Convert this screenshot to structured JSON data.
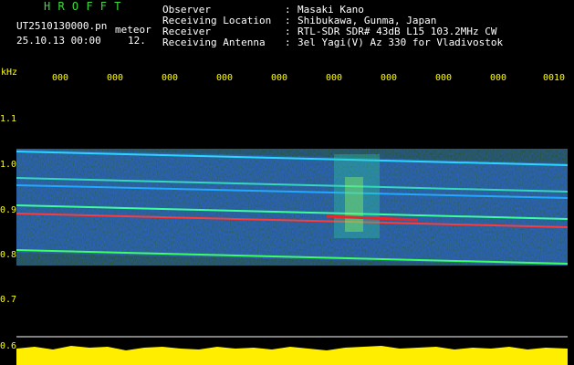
{
  "title": "H R O F F T",
  "file": {
    "filename": "UT2510130000.pn",
    "mode": "meteor",
    "datetime": "25.10.13 00:00",
    "datetime_suffix": "12."
  },
  "meta": [
    {
      "label": "Observer",
      "value": "Masaki Kano"
    },
    {
      "label": "Receiving Location",
      "value": "Shibukawa, Gunma, Japan"
    },
    {
      "label": "Receiver",
      "value": "RTL-SDR SDR# 43dB L15 103.2MHz CW"
    },
    {
      "label": "Receiving Antenna",
      "value": "3el Yagi(V) Az 330 for Vladivostok"
    }
  ],
  "separator": ":",
  "axis": {
    "y_unit": "kHz",
    "y_ticks": [
      "1.1",
      "1.0",
      "0.9",
      "0.8",
      "0.7",
      "0.6"
    ],
    "x_ticks": [
      "000",
      "000",
      "000",
      "000",
      "000",
      "000",
      "000",
      "000",
      "000",
      "0010"
    ]
  },
  "colors": {
    "background": "#000000",
    "spectrum_base": "#0a1c8c",
    "spectrum_hot": "#ff2020",
    "header_title": "#3cdc3c",
    "labels": "#ffff00",
    "baseline": "#ffee00"
  }
}
